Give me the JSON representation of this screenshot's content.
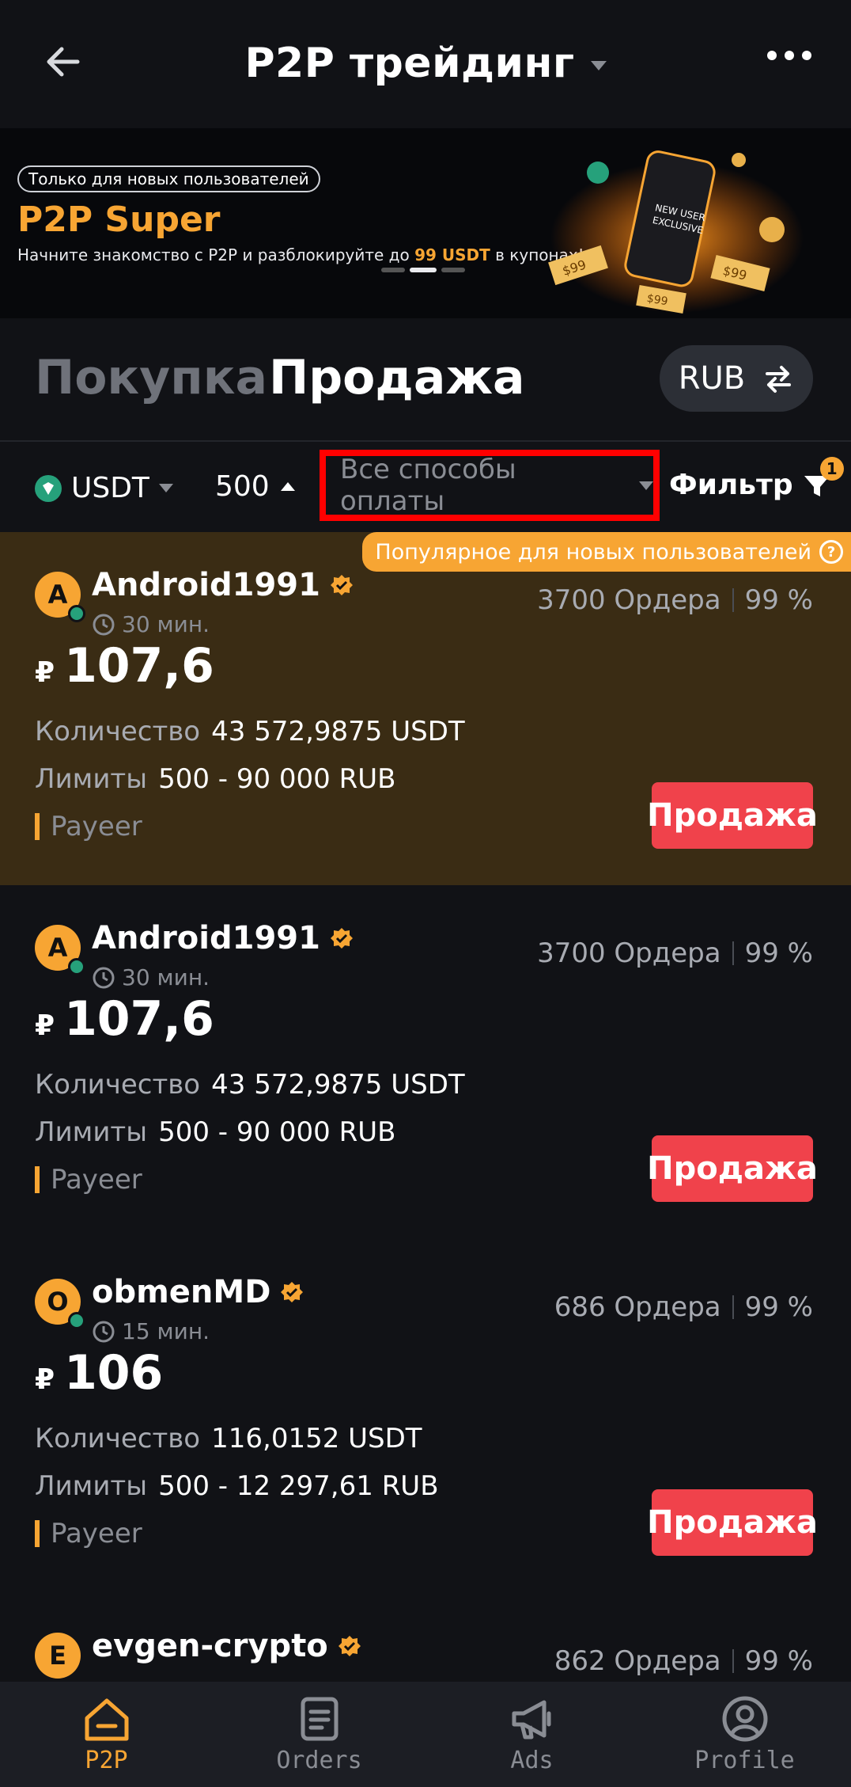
{
  "header": {
    "title": "P2P трейдинг"
  },
  "banner": {
    "badge": "Только для новых пользователей",
    "title": "P2P Super",
    "desc_prefix": "Начните знакомство с P2P и разблокируйте до ",
    "desc_highlight": "99 USDT",
    "desc_suffix": " в купонах!",
    "art_label_1": "NEW USER",
    "art_label_2": "EXCLUSIVE",
    "coupon": "$99"
  },
  "tabs": {
    "buy": "Покупка",
    "sell": "Продажа",
    "currency": "RUB"
  },
  "filters": {
    "coin": "USDT",
    "amount": "500",
    "payment": "Все способы оплаты",
    "filter_label": "Фильтр",
    "filter_count": "1"
  },
  "popular_tag": "Популярное для новых пользователей",
  "labels": {
    "quantity": "Количество",
    "limits": "Лимиты",
    "sell_button": "Продажа",
    "ruble": "₽"
  },
  "listings": [
    {
      "initial": "A",
      "name": "Android1991",
      "time": "30 мин.",
      "orders": "3700 Ордера",
      "rate": "99 %",
      "price": "107,6",
      "quantity": "43 572,9875 USDT",
      "limits": "500 - 90 000 RUB",
      "payment": "Payeer"
    },
    {
      "initial": "A",
      "name": "Android1991",
      "time": "30 мин.",
      "orders": "3700 Ордера",
      "rate": "99 %",
      "price": "107,6",
      "quantity": "43 572,9875 USDT",
      "limits": "500 - 90 000 RUB",
      "payment": "Payeer"
    },
    {
      "initial": "O",
      "name": "obmenMD",
      "time": "15 мин.",
      "orders": "686 Ордера",
      "rate": "99 %",
      "price": "106",
      "quantity": "116,0152 USDT",
      "limits": "500 - 12 297,61 RUB",
      "payment": "Payeer"
    },
    {
      "initial": "E",
      "name": "evgen-crypto",
      "orders": "862 Ордера",
      "rate": "99 %"
    }
  ],
  "nav": [
    {
      "label": "P2P"
    },
    {
      "label": "Orders"
    },
    {
      "label": "Ads"
    },
    {
      "label": "Profile"
    }
  ],
  "colors": {
    "accent": "#f7a533",
    "sell": "#f0424b",
    "background": "#111216",
    "highlight": "#3a2c14"
  }
}
